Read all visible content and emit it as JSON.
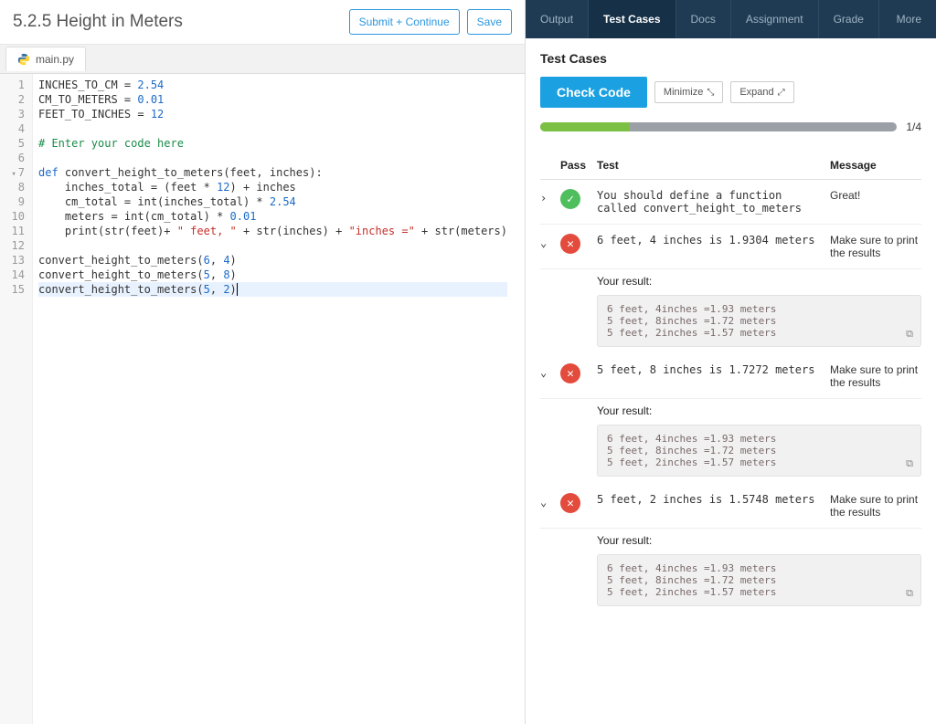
{
  "header": {
    "title": "5.2.5 Height in Meters",
    "submit_continue": "Submit + Continue",
    "save": "Save"
  },
  "file_tab": {
    "name": "main.py"
  },
  "code": {
    "lines": [
      {
        "n": "1",
        "html": "INCHES_TO_CM = <span class='tok-num'>2.54</span>"
      },
      {
        "n": "2",
        "html": "CM_TO_METERS = <span class='tok-num'>0.01</span>"
      },
      {
        "n": "3",
        "html": "FEET_TO_INCHES = <span class='tok-num'>12</span>"
      },
      {
        "n": "4",
        "html": ""
      },
      {
        "n": "5",
        "html": "<span class='tok-com'># Enter your code here</span>"
      },
      {
        "n": "6",
        "html": ""
      },
      {
        "n": "7",
        "fold": true,
        "html": "<span class='tok-kw'>def</span> <span class='tok-fn'>convert_height_to_meters</span>(feet, inches):"
      },
      {
        "n": "8",
        "html": "    inches_total = (feet * <span class='tok-num'>12</span>) + inches"
      },
      {
        "n": "9",
        "html": "    cm_total = int(inches_total) * <span class='tok-num'>2.54</span>"
      },
      {
        "n": "10",
        "html": "    meters = int(cm_total) * <span class='tok-num'>0.01</span>"
      },
      {
        "n": "11",
        "html": "    print(str(feet)+ <span class='tok-str'>\" feet, \"</span> + str(inches) + <span class='tok-str'>\"inches =\"</span> + str(meters)"
      },
      {
        "n": "12",
        "html": ""
      },
      {
        "n": "13",
        "html": "convert_height_to_meters(<span class='tok-num'>6</span>, <span class='tok-num'>4</span>)"
      },
      {
        "n": "14",
        "html": "convert_height_to_meters(<span class='tok-num'>5</span>, <span class='tok-num'>8</span>)"
      },
      {
        "n": "15",
        "hl": true,
        "html": "convert_height_to_meters(<span class='tok-num'>5</span>, <span class='tok-num'>2</span>)<span style='border-left:1px solid #000;'>&nbsp;</span>"
      }
    ]
  },
  "right_nav": {
    "items": [
      "Output",
      "Test Cases",
      "Docs",
      "Assignment",
      "Grade",
      "More"
    ],
    "active_index": 1
  },
  "panel": {
    "title": "Test Cases",
    "check_code": "Check Code",
    "minimize": "Minimize",
    "expand": "Expand",
    "progress": {
      "passed": 1,
      "total": 4,
      "label": "1/4",
      "percent": 25
    }
  },
  "columns": {
    "pass": "Pass",
    "test": "Test",
    "message": "Message"
  },
  "your_result_label": "Your result:",
  "result_output": "6 feet, 4inches =1.93 meters\n5 feet, 8inches =1.72 meters\n5 feet, 2inches =1.57 meters",
  "tests": [
    {
      "expanded": false,
      "pass": true,
      "test": "You should define a function called convert_height_to_meters",
      "message": "Great!"
    },
    {
      "expanded": true,
      "pass": false,
      "test": "6 feet, 4 inches is 1.9304 meters",
      "message": "Make sure to print the results"
    },
    {
      "expanded": true,
      "pass": false,
      "test": "5 feet, 8 inches is 1.7272 meters",
      "message": "Make sure to print the results"
    },
    {
      "expanded": true,
      "pass": false,
      "test": "5 feet, 2 inches is 1.5748 meters",
      "message": "Make sure to print the results"
    }
  ]
}
